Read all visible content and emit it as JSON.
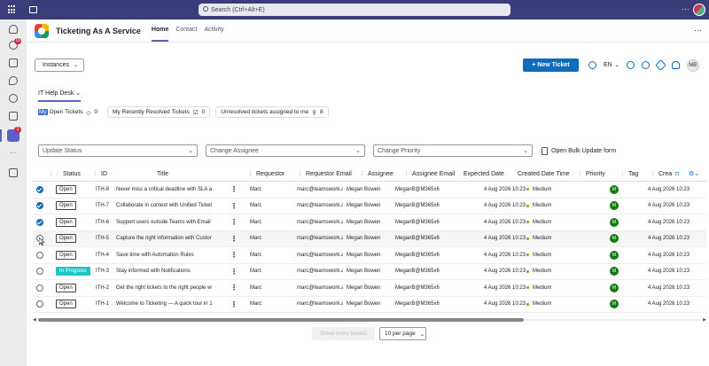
{
  "topbar": {
    "search_placeholder": "Search (Ctrl+Alt+E)"
  },
  "rail": {
    "badges": [
      "15",
      "1"
    ]
  },
  "app": {
    "title": "Ticketing As A Service",
    "nav": [
      "Home",
      "Contact",
      "Activity"
    ],
    "instances_label": "Instances",
    "new_ticket_label": "+ New Ticket",
    "language": "EN",
    "user_initials": "MB"
  },
  "workspace": "IT Help Desk",
  "views": [
    {
      "label_hl": "My",
      "label": " Open Tickets",
      "count": "0"
    },
    {
      "label_hl": "",
      "label": "My Recently Resolved Tickets",
      "count": "0"
    },
    {
      "label_hl": "",
      "label": "Unresolved tickets assigned to me",
      "count": "8"
    }
  ],
  "filters": [
    "Update Status",
    "Change Assignee",
    "Change Priority"
  ],
  "bulk_label": "Open Bulk Update form",
  "columns": [
    "Status",
    "ID",
    "Title",
    "Requestor",
    "Requestor Email",
    "Assignee",
    "Assignee Email",
    "Expected Date",
    "Created Date Time",
    "Priority",
    "Tag",
    "Crea"
  ],
  "tickets": [
    {
      "checked": true,
      "status": "Open",
      "id": "ITH-8",
      "title": "Never miss a critical deadline with SLA and e",
      "requestor": "Marc",
      "req_email": "marc@teamswork.ap",
      "assignee": "Megan Bowen",
      "asg_email": "MeganB@M365x665",
      "expected": "",
      "created": "4 Aug 2026 10:23",
      "priority": "Medium",
      "avatar": "M",
      "tag": "",
      "crea": "4 Aug 2026 10:23"
    },
    {
      "checked": true,
      "status": "Open",
      "id": "ITH-7",
      "title": "Collaborate in context with Unified Ticket Ch",
      "requestor": "Marc",
      "req_email": "marc@teamswork.ap",
      "assignee": "Megan Bowen",
      "asg_email": "MeganB@M365x665",
      "expected": "",
      "created": "4 Aug 2026 10:23",
      "priority": "Medium",
      "avatar": "M",
      "tag": "",
      "crea": "4 Aug 2026 10:23"
    },
    {
      "checked": true,
      "status": "Open",
      "id": "ITH-6",
      "title": "Support users outside Teams with Email to T",
      "requestor": "Marc",
      "req_email": "marc@teamswork.ap",
      "assignee": "Megan Bowen",
      "asg_email": "MeganB@M365x665",
      "expected": "",
      "created": "4 Aug 2026 10:23",
      "priority": "Medium",
      "avatar": "M",
      "tag": "",
      "crea": "4 Aug 2026 10:23"
    },
    {
      "checked": false,
      "status": "Open",
      "id": "ITH-5",
      "title": "Capture the right information with Custom F",
      "requestor": "Marc",
      "req_email": "marc@teamswork.ap",
      "assignee": "Megan Bowen",
      "asg_email": "MeganB@M365x665",
      "expected": "",
      "created": "4 Aug 2026 10:23",
      "priority": "Medium",
      "avatar": "M",
      "tag": "",
      "crea": "4 Aug 2026 10:23"
    },
    {
      "checked": false,
      "status": "Open",
      "id": "ITH-4",
      "title": "Save time with Automation Rules",
      "requestor": "Marc",
      "req_email": "marc@teamswork.ap",
      "assignee": "Megan Bowen",
      "asg_email": "MeganB@M365x665",
      "expected": "",
      "created": "4 Aug 2026 10:23",
      "priority": "Medium",
      "avatar": "M",
      "tag": "",
      "crea": "4 Aug 2026 10:23"
    },
    {
      "checked": false,
      "status": "In Progress",
      "id": "ITH-3",
      "title": "Stay informed with Notifications",
      "requestor": "Marc",
      "req_email": "marc@teamswork.ap",
      "assignee": "Megan Bowen",
      "asg_email": "MeganB@M365x665",
      "expected": "",
      "created": "4 Aug 2026 10:23",
      "priority": "Medium",
      "avatar": "M",
      "tag": "",
      "crea": "4 Aug 2026 10:23"
    },
    {
      "checked": false,
      "status": "Open",
      "id": "ITH-2",
      "title": "Get the right tickets to the right people with",
      "requestor": "Marc",
      "req_email": "marc@teamswork.ap",
      "assignee": "Megan Bowen",
      "asg_email": "MeganB@M365x665",
      "expected": "",
      "created": "4 Aug 2026 10:23",
      "priority": "Medium",
      "avatar": "M",
      "tag": "",
      "crea": "4 Aug 2026 10:23"
    },
    {
      "checked": false,
      "status": "Open",
      "id": "ITH-1",
      "title": "Welcome to Ticketing — A quick tour in 10 t",
      "requestor": "Marc",
      "req_email": "marc@teamswork.ap",
      "assignee": "Megan Bowen",
      "asg_email": "MeganB@M365x665",
      "expected": "",
      "created": "4 Aug 2026 10:23",
      "priority": "Medium",
      "avatar": "M",
      "tag": "",
      "crea": "4 Aug 2026 10:23"
    }
  ],
  "paging": {
    "show_more": "Show more tickets",
    "per_page": "10 per page"
  }
}
